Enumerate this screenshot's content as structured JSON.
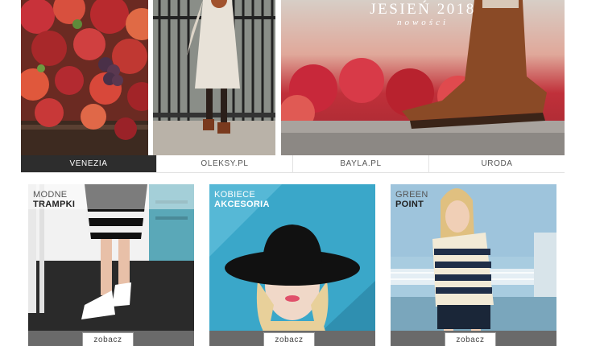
{
  "banner": {
    "title": "JESIEŃ 2018",
    "subtitle": "nowości"
  },
  "tabs": [
    {
      "label": "VENEZIA",
      "active": true
    },
    {
      "label": "OLEKSY.PL",
      "active": false
    },
    {
      "label": "BAYLA.PL",
      "active": false
    },
    {
      "label": "URODA",
      "active": false
    }
  ],
  "cards": [
    {
      "line1": "MODNE",
      "line2": "TRAMPKI",
      "button": "zobacz"
    },
    {
      "line1": "KOBIECE",
      "line2": "AKCESORIA",
      "button": "zobacz"
    },
    {
      "line1": "GREEN",
      "line2": "POINT",
      "button": "zobacz"
    }
  ],
  "colors": {
    "tab_active_bg": "#2d2d2d",
    "footer_bar": "#6a6a6a",
    "accessory_bg": "#3aa7c9"
  }
}
